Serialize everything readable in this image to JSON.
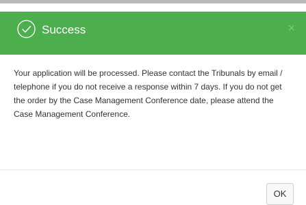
{
  "dialog": {
    "title": "Success",
    "close_symbol": "×",
    "header_icon": "check-circle-icon",
    "close_icon": "close-icon",
    "message": "Your application will be processed. Please contact the Tribunals by email / telephone if you do not receive a response within 7 days. If you do not get the order by the Case Management Conference date, please attend the Case Management Conference.",
    "ok_label": "OK"
  },
  "colors": {
    "header_background": "#4cae4c",
    "header_text": "#ffffff",
    "body_text": "#333333",
    "button_border": "#cfcfcf"
  }
}
